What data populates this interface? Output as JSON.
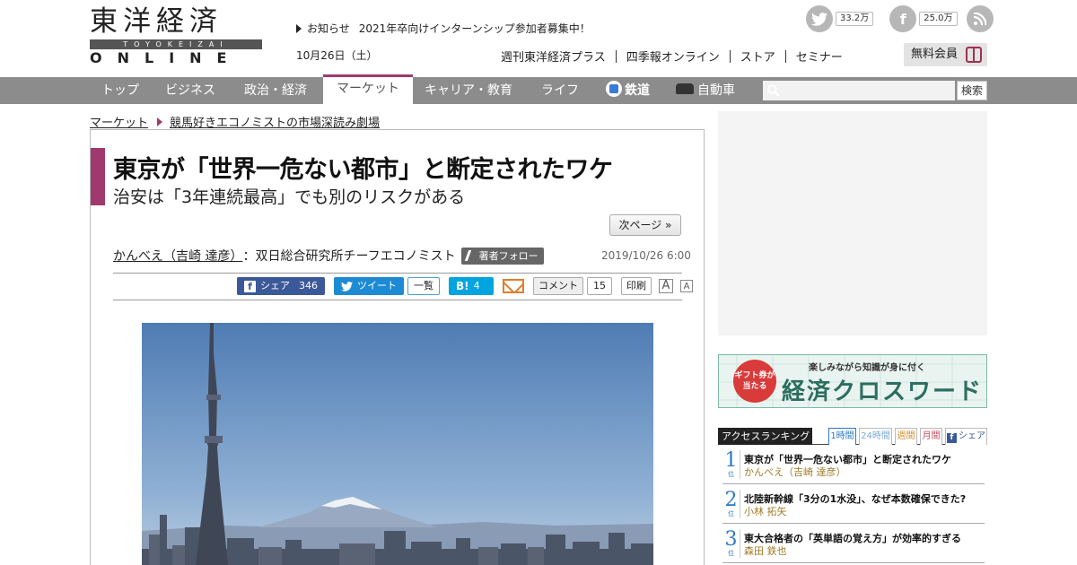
{
  "logo": {
    "kanji": "東洋経済",
    "romaji": "TOYOKEIZAI",
    "online": "ONLINE"
  },
  "header": {
    "notice_label": "お知らせ",
    "notice_text": "2021年卒向けインターンシップ参加者募集中！",
    "date": "10月26日（土）",
    "twitter_count": "33.2万",
    "facebook_count": "25.0万",
    "nav": [
      "週刊東洋経済プラス",
      "四季報オンライン",
      "ストア",
      "セミナー"
    ],
    "member_button": "無料会員"
  },
  "categories": [
    "トップ",
    "ビジネス",
    "政治・経済",
    "マーケット",
    "キャリア・教育",
    "ライフ",
    "鉄道",
    "自動車"
  ],
  "active_category": "マーケット",
  "search": {
    "placeholder": "",
    "button": "検索"
  },
  "breadcrumb": {
    "section": "マーケット",
    "series": "競馬好きエコノミストの市場深読み劇場"
  },
  "article": {
    "title": "東京が「世界一危ない都市」と断定されたワケ",
    "subtitle": "治安は「3年連続最高」でも別のリスクがある",
    "next_page": "次ページ »",
    "author": "かんべえ（吉崎 達彦）",
    "author_title": "：双日総合研究所チーフエコノミスト",
    "follow": "著者フォロー",
    "published": "2019/10/26 6:00"
  },
  "share": {
    "facebook_label": "シェア",
    "facebook_count": "346",
    "tweet_label": "ツイート",
    "tweet_list": "一覧",
    "hatena_label": "B!",
    "hatena_count": "4",
    "comment_label": "コメント",
    "comment_count": "15",
    "print_label": "印刷",
    "font_large": "A",
    "font_small": "A"
  },
  "sidebar": {
    "crossword_badge": "ギフト券が当たる",
    "crossword_tag": "楽しみながら知識が身に付く",
    "crossword_title": "経済クロスワード",
    "ranking_title": "アクセスランキング",
    "ranking_tabs": [
      "1時間",
      "24時間",
      "週間",
      "月間",
      "シェア"
    ],
    "ranking_unit": "位",
    "ranking": [
      {
        "rank": "1",
        "title": "東京が「世界一危ない都市」と断定されたワケ",
        "author": "かんべえ（吉崎 達彦）"
      },
      {
        "rank": "2",
        "title": "北陸新幹線「3分の1水没」、なぜ本数確保できた?",
        "author": "小林 拓矢"
      },
      {
        "rank": "3",
        "title": "東大合格者の「英単語の覚え方」が効率的すぎる",
        "author": "森田 鉄也"
      }
    ]
  },
  "colors": {
    "accent": "#a03a6e",
    "category_bar": "#8c8c8c",
    "facebook": "#3b5998",
    "twitter": "#1da1f2",
    "hatena": "#00a4de",
    "rank_number": "#2a78c7"
  }
}
